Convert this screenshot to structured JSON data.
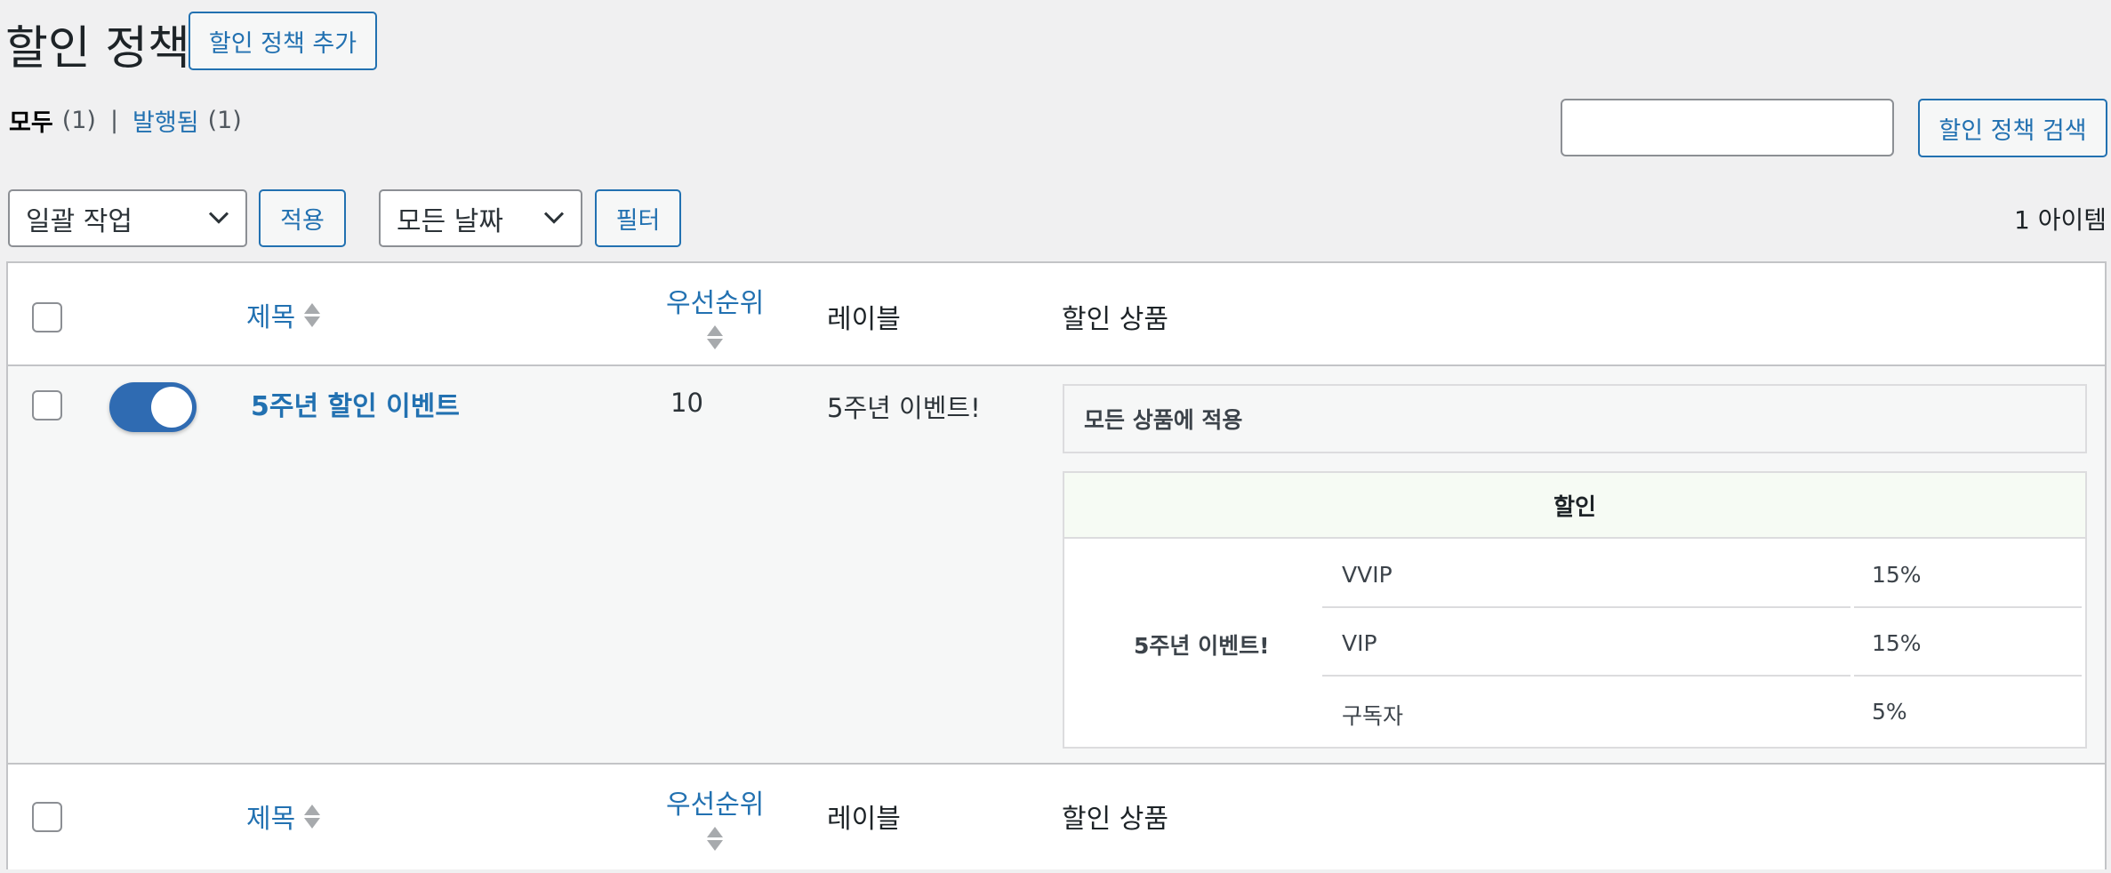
{
  "header": {
    "title": "할인 정책",
    "add_button": "할인 정책 추가"
  },
  "views": {
    "all_label": "모두",
    "all_count": "(1)",
    "separator": "|",
    "published_label": "발행됨",
    "published_count": "(1)"
  },
  "search": {
    "value": "",
    "button_label": "할인 정책 검색"
  },
  "toolbar": {
    "bulk_action_selected": "일괄 작업",
    "apply_label": "적용",
    "date_selected": "모든 날짜",
    "filter_label": "필터",
    "item_count": "1 아이템"
  },
  "columns": {
    "title": "제목",
    "priority": "우선순위",
    "label": "레이블",
    "products": "할인 상품"
  },
  "rows": [
    {
      "enabled": true,
      "title": "5주년 할인 이벤트",
      "priority": "10",
      "label": "5주년 이벤트!",
      "products_scope": "모든 상품에 적용",
      "discount_header": "할인",
      "discount_event": "5주년 이벤트!",
      "tiers": [
        {
          "name": "VVIP",
          "percent": "15%"
        },
        {
          "name": "VIP",
          "percent": "15%"
        },
        {
          "name": "구독자",
          "percent": "5%"
        }
      ]
    }
  ],
  "colors": {
    "accent": "#2271b1",
    "toggle_on": "#2f6bb2",
    "background": "#f0f0f1",
    "border": "#c3c4c7"
  },
  "icons": {
    "select_chevron": "chevron-down-icon",
    "sort": "sort-arrows-icon"
  }
}
